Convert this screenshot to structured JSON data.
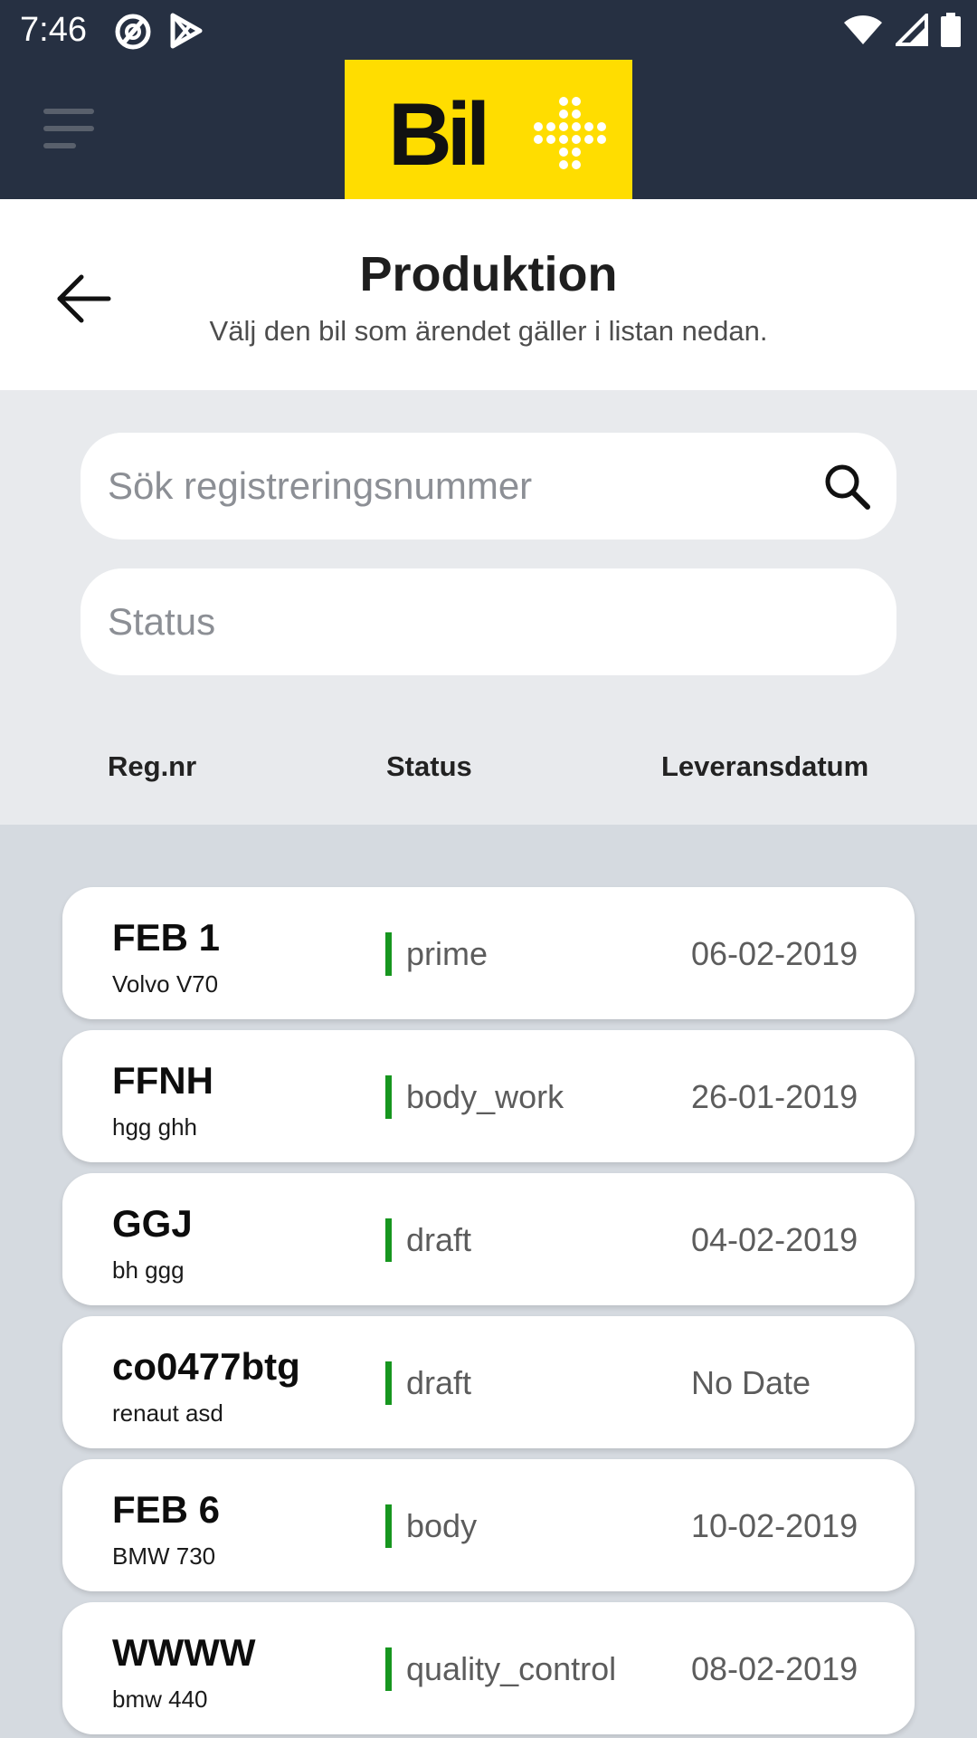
{
  "status_bar": {
    "time": "7:46"
  },
  "header": {
    "title": "Produktion",
    "subtitle": "Välj den bil som ärendet gäller i listan nedan."
  },
  "search": {
    "placeholder": "Sök registreringsnummer",
    "value": ""
  },
  "status_filter": {
    "placeholder": "Status",
    "value": ""
  },
  "columns": {
    "reg": "Reg.nr",
    "status": "Status",
    "date": "Leveransdatum"
  },
  "cars": [
    {
      "reg": "FEB 1",
      "model": "Volvo V70",
      "status": "prime",
      "date": "06-02-2019"
    },
    {
      "reg": "FFNH",
      "model": "hgg ghh",
      "status": "body_work",
      "date": "26-01-2019"
    },
    {
      "reg": "GGJ",
      "model": "bh ggg",
      "status": "draft",
      "date": "04-02-2019"
    },
    {
      "reg": "co0477btg",
      "model": "renaut asd",
      "status": "draft",
      "date": "No Date"
    },
    {
      "reg": "FEB 6",
      "model": "BMW 730",
      "status": "body",
      "date": "10-02-2019"
    },
    {
      "reg": "WWWW",
      "model": "bmw 440",
      "status": "quality_control",
      "date": "08-02-2019"
    }
  ],
  "colors": {
    "app_bar": "#263042",
    "logo_bg": "#ffdd00",
    "status_accent": "#17961f",
    "list_bg": "#d5dae0"
  },
  "icons": [
    "notification-icon",
    "play-store-icon",
    "wifi-icon",
    "signal-icon",
    "battery-icon",
    "menu-icon",
    "logo-icon",
    "back-arrow-icon",
    "search-icon"
  ]
}
